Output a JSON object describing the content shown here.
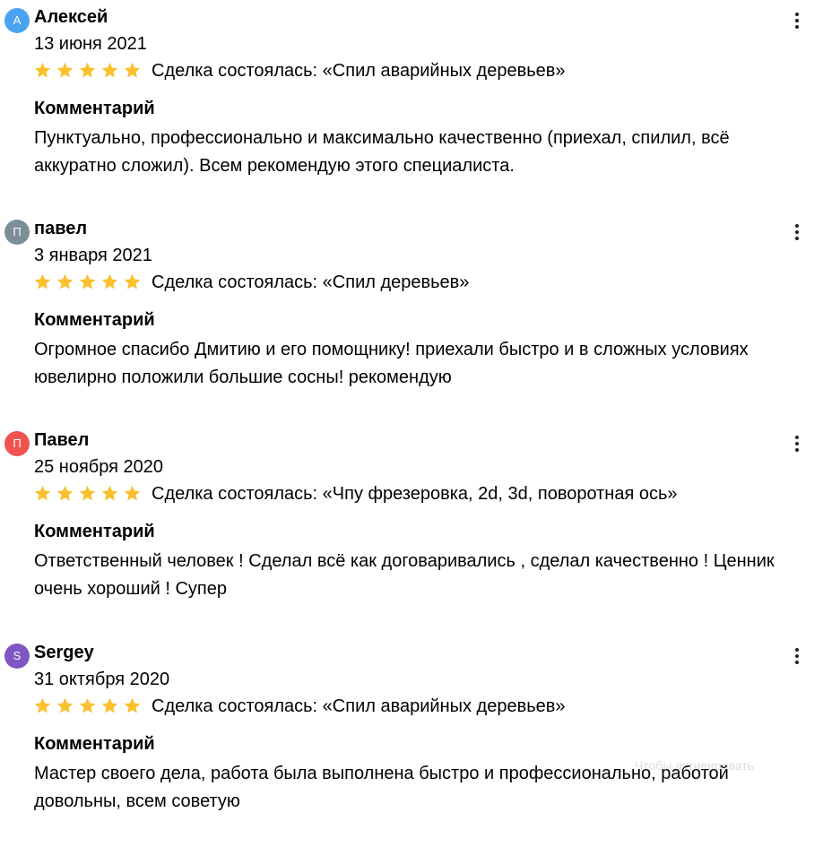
{
  "reviews": [
    {
      "avatar_letter": "А",
      "avatar_color": "#4aa3f0",
      "name": "Алексей",
      "date": "13 июня 2021",
      "rating": 5,
      "deal": "Сделка состоялась: «Спил аварийных деревьев»",
      "comment_title": "Комментарий",
      "comment": "Пунктуально, профессионально и максимально качественно (приехал, спилил, всё аккуратно сложил). Всем рекомендую этого специалиста."
    },
    {
      "avatar_letter": "П",
      "avatar_color": "#7d8e99",
      "name": "павел",
      "date": "3 января 2021",
      "rating": 5,
      "deal": "Сделка состоялась: «Спил деревьев»",
      "comment_title": "Комментарий",
      "comment": "Огромное спасибо Дмитию и его помощнику! приехали быстро и в сложных условиях ювелирно положили большие сосны! рекомендую"
    },
    {
      "avatar_letter": "П",
      "avatar_color": "#ef5350",
      "name": "Павел",
      "date": "25 ноября 2020",
      "rating": 5,
      "deal": "Сделка состоялась: «Чпу фрезеровка, 2d, 3d, поворотная ось»",
      "comment_title": "Комментарий",
      "comment": "Ответственный человек ! Сделал всё как договаривались , сделал качественно ! Ценник очень хороший ! Супер"
    },
    {
      "avatar_letter": "S",
      "avatar_color": "#7e57c2",
      "name": "Sergey",
      "date": "31 октября 2020",
      "rating": 5,
      "deal": "Сделка состоялась: «Спил аварийных деревьев»",
      "comment_title": "Комментарий",
      "comment": "Мастер своего дела, работа была выполнена быстро и профессионально, работой довольны, всем советую"
    }
  ],
  "star_color": "#fbc02d",
  "menu_icon": "more-vertical-icon",
  "watermark": "Чтобы активировать"
}
